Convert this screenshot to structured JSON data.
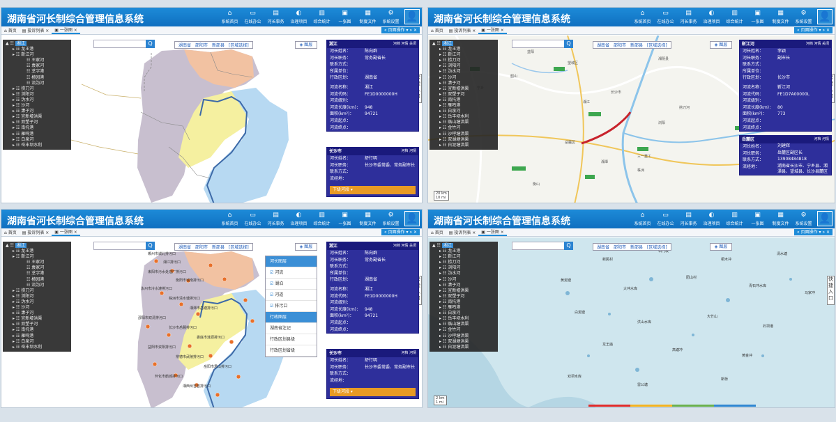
{
  "app": {
    "title": "湖南省河长制综合管理信息系统",
    "nav": [
      {
        "label": "系统首页",
        "icon": "home-icon",
        "glyph": "⌂"
      },
      {
        "label": "在线办公",
        "icon": "monitor-icon",
        "glyph": "▭"
      },
      {
        "label": "河长事务",
        "icon": "document-icon",
        "glyph": "▤"
      },
      {
        "label": "治理项目",
        "icon": "globe-icon",
        "glyph": "◐"
      },
      {
        "label": "综合统计",
        "icon": "chart-icon",
        "glyph": "▥"
      },
      {
        "label": "一张图",
        "icon": "map-icon",
        "glyph": "▣"
      },
      {
        "label": "制度文件",
        "icon": "file-icon",
        "glyph": "▦"
      },
      {
        "label": "系统设置",
        "icon": "gear-icon",
        "glyph": "⚙"
      }
    ],
    "user_glyph": "👤",
    "tabs": {
      "home": "首页",
      "river_list": "投诉列表",
      "onemap": "一张图"
    },
    "page_ops": "页面操作"
  },
  "search": {
    "btn": "Q"
  },
  "regions": [
    "湖南省",
    "邵阳市",
    "新邵县",
    "[区域选择]"
  ],
  "layer_btn": "图层",
  "quick_entry": "快捷入口",
  "tree": {
    "root": "湘江",
    "items": [
      {
        "label": "龙王港",
        "level": 1
      },
      {
        "label": "靳江河",
        "level": 1
      },
      {
        "label": "王家河",
        "level": 2
      },
      {
        "label": "袁家河",
        "level": 2
      },
      {
        "label": "芝字港",
        "level": 2
      },
      {
        "label": "楂园港",
        "level": 2
      },
      {
        "label": "流沩河",
        "level": 2
      },
      {
        "label": "捞刀河",
        "level": 1
      },
      {
        "label": "浏阳河",
        "level": 1
      },
      {
        "label": "沩水河",
        "level": 1
      },
      {
        "label": "沙河",
        "level": 1
      },
      {
        "label": "潇子河",
        "level": 1
      },
      {
        "label": "宜新墟洪渠",
        "level": 1
      },
      {
        "label": "双塑子河",
        "level": 1
      },
      {
        "label": "南托港",
        "level": 1
      },
      {
        "label": "雁鸣港",
        "level": 1
      },
      {
        "label": "白泉河",
        "level": 1
      },
      {
        "label": "岳丰坝水利",
        "level": 1
      }
    ],
    "items_short": [
      {
        "label": "龙王港",
        "level": 1
      },
      {
        "label": "靳江河",
        "level": 1
      },
      {
        "label": "捞刀河",
        "level": 1
      },
      {
        "label": "浏阳河",
        "level": 1
      },
      {
        "label": "沩水河",
        "level": 1
      },
      {
        "label": "沙河",
        "level": 1
      },
      {
        "label": "潇子河",
        "level": 1
      },
      {
        "label": "宜新墟洪渠",
        "level": 1
      },
      {
        "label": "双塑子河",
        "level": 1
      },
      {
        "label": "南托港",
        "level": 1
      },
      {
        "label": "雁鸣港",
        "level": 1
      },
      {
        "label": "白泉河",
        "level": 1
      },
      {
        "label": "岳丰坝水利",
        "level": 1
      },
      {
        "label": "临山塘洪渠",
        "level": 1
      },
      {
        "label": "金竹河",
        "level": 1
      },
      {
        "label": "沙呼塘洪渠",
        "level": 1
      },
      {
        "label": "双湖塘洪渠",
        "level": 1
      },
      {
        "label": "白泥塘洪渠",
        "level": 1
      }
    ]
  },
  "info_xiang": {
    "title": "湘江",
    "actions": "河档 河情 关闭",
    "rows": [
      {
        "k": "河长姓名：",
        "v": "陈向群"
      },
      {
        "k": "河长职务：",
        "v": "常务副省长"
      },
      {
        "k": "联系方式：",
        "v": ""
      },
      {
        "k": "所属单位：",
        "v": ""
      },
      {
        "k": "行政区划：",
        "v": "湖南省"
      }
    ],
    "rows2": [
      {
        "k": "河流名称：",
        "v": "湘江"
      },
      {
        "k": "河流代码：",
        "v": "FE1D0000000H"
      },
      {
        "k": "河流级别：",
        "v": ""
      },
      {
        "k": "河流长度(km)：",
        "v": "948"
      },
      {
        "k": "面积(km²)：",
        "v": "94721"
      },
      {
        "k": "河流起点：",
        "v": ""
      },
      {
        "k": "河流终点：",
        "v": ""
      }
    ]
  },
  "info_changsha": {
    "title": "长沙市",
    "actions": "河档 河情",
    "rows": [
      {
        "k": "河长姓名：",
        "v": "舒行明"
      },
      {
        "k": "河长职务：",
        "v": "长沙市委常委、常务副市长"
      },
      {
        "k": "联系方式：",
        "v": ""
      },
      {
        "k": "流经地：",
        "v": ""
      }
    ],
    "button": "下级河段 ▾"
  },
  "info_jinjiang": {
    "title": "靳江河",
    "actions": "河档 河情 关闭",
    "rows": [
      {
        "k": "河长姓名：",
        "v": "李颖"
      },
      {
        "k": "河长职务：",
        "v": "副市长"
      },
      {
        "k": "联系方式：",
        "v": ""
      },
      {
        "k": "所属单位：",
        "v": ""
      },
      {
        "k": "行政区划：",
        "v": "长沙市"
      }
    ],
    "rows2": [
      {
        "k": "河流名称：",
        "v": "靳江河"
      },
      {
        "k": "河流代码：",
        "v": "FE1D7A00000L"
      },
      {
        "k": "河流级别：",
        "v": ""
      },
      {
        "k": "河流长度(km)：",
        "v": "80"
      },
      {
        "k": "面积(km²)：",
        "v": "773"
      },
      {
        "k": "河流起点：",
        "v": ""
      },
      {
        "k": "河流终点：",
        "v": ""
      }
    ]
  },
  "info_yuelu": {
    "title": "岳麓区",
    "actions": "河档 河情",
    "rows": [
      {
        "k": "河长姓名：",
        "v": "刘建辉"
      },
      {
        "k": "河长职务：",
        "v": "岳麓区副区长"
      },
      {
        "k": "联系方式：",
        "v": "13908484818"
      },
      {
        "k": "流经地：",
        "v": "湖南省长沙市、宁乡县、湘潭县、望城县、长沙县麓区"
      }
    ]
  },
  "layer_popup": {
    "items": [
      {
        "label": "河长图层",
        "hl": true
      },
      {
        "label": "河流",
        "cb": true
      },
      {
        "label": "湖泊",
        "cb": true
      },
      {
        "label": "河道",
        "cb": true
      },
      {
        "label": "排污口",
        "cb": true
      },
      {
        "label": "行政图层",
        "hl": true
      },
      {
        "label": "湖南省注记"
      },
      {
        "label": "行政区划县级"
      },
      {
        "label": "行政区划省级"
      }
    ]
  },
  "scale": {
    "a": "20 km",
    "b": "10 mi",
    "c": "2 km",
    "d": "1 mi"
  },
  "map_labels": {
    "p1": [
      "韶山",
      "宁乡",
      "望城区",
      "长沙市",
      "益阳",
      "湘阴县",
      "岳麓区",
      "浏阳",
      "三一重工",
      "湘江",
      "湘潭",
      "株洲",
      "衡山",
      "捞刀河"
    ],
    "p3": [
      "东山坡",
      "新民村",
      "石门坡",
      "桐木冲",
      "清水塘",
      "黄泥塘",
      "大冲水库",
      "团山村",
      "青石冲水库",
      "马家冲",
      "白泥塘",
      "洪山水库",
      "大竹山",
      "石坝港",
      "龙王庙",
      "高塘冲",
      "黄金冲",
      "双坝水库",
      "雷公塘",
      "新桥"
    ],
    "p2": [
      "郴州市城北排污口",
      "湘江排污口",
      "耒阳市污水处理厂排污口",
      "衡阳市城南排污口",
      "永州市冷水滩排污口",
      "株洲市清水塘排污口",
      "湘潭市岳塘排污口",
      "邵阳市双清排污口",
      "长沙市岳麓排污口",
      "娄底市涟源排污口",
      "益阳市资阳排污口",
      "常德市武陵排污口",
      "岳阳市君山排污口",
      "怀化市鹤城排污口",
      "湘西州吉首排污口"
    ]
  }
}
